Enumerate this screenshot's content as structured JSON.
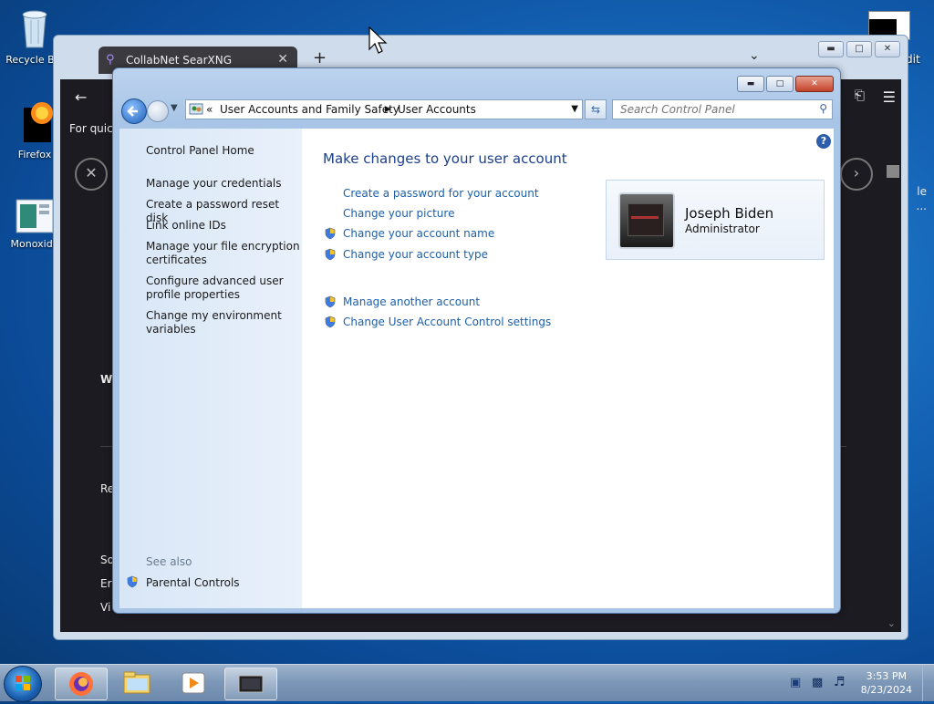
{
  "desktop": {
    "icons": [
      {
        "label": "Recycle Bin"
      },
      {
        "label": "Firefox"
      },
      {
        "label": "Monoxide"
      }
    ],
    "right_icon_label_1": "dit",
    "right_icon_label_2": "le",
    "right_icon_label_3": "..."
  },
  "browser": {
    "tab_title": "CollabNet SearXNG",
    "tab_close": "✕",
    "new_tab": "+",
    "tab_list": "⌄",
    "quick_text": "For quick",
    "side_texts": [
      "W",
      "Re",
      "So",
      "Er",
      "Vi"
    ]
  },
  "control_panel": {
    "address": {
      "root": "«",
      "crumb1": "User Accounts and Family Safety",
      "crumb2": "User Accounts"
    },
    "search_placeholder": "Search Control Panel",
    "sidebar": {
      "home": "Control Panel Home",
      "links": [
        "Manage your credentials",
        "Create a password reset disk",
        "Link online IDs",
        "Manage your file encryption certificates",
        "Configure advanced user profile properties",
        "Change my environment variables"
      ],
      "see_also": "See also",
      "parental": "Parental Controls"
    },
    "main": {
      "heading": "Make changes to your user account",
      "links": [
        "Create a password for your account",
        "Change your picture",
        "Change your account name",
        "Change your account type"
      ],
      "links2": [
        "Manage another account",
        "Change User Account Control settings"
      ]
    },
    "account": {
      "name": "Joseph Biden",
      "role": "Administrator"
    }
  },
  "taskbar": {
    "time": "3:53 PM",
    "date": "8/23/2024"
  }
}
